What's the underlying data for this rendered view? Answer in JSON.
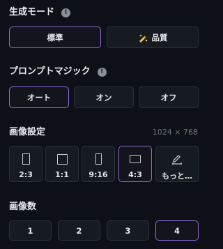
{
  "generation_mode": {
    "title": "生成モード",
    "options": [
      {
        "label": "標準",
        "selected": true
      },
      {
        "label": "品質",
        "selected": false,
        "icon": "sparkle-pen-icon"
      }
    ]
  },
  "prompt_magic": {
    "title": "プロンプトマジック",
    "options": [
      {
        "label": "オート",
        "selected": true
      },
      {
        "label": "オン",
        "selected": false
      },
      {
        "label": "オフ",
        "selected": false
      }
    ]
  },
  "image_settings": {
    "title": "画像設定",
    "resolution": "1024 × 768",
    "ratios": [
      {
        "label": "2:3",
        "selected": false
      },
      {
        "label": "1:1",
        "selected": false
      },
      {
        "label": "9:16",
        "selected": false
      },
      {
        "label": "4:3",
        "selected": true
      },
      {
        "label": "もっと…",
        "selected": false,
        "icon": "pencil-icon"
      }
    ]
  },
  "image_count": {
    "title": "画像数",
    "options": [
      {
        "label": "1",
        "selected": false
      },
      {
        "label": "2",
        "selected": false
      },
      {
        "label": "3",
        "selected": false
      },
      {
        "label": "4",
        "selected": true
      }
    ]
  },
  "colors": {
    "background": "#0d1117",
    "button_bg": "#161b22",
    "border": "#2c323b",
    "selected_border": "#8f6bd6",
    "accent_yellow": "#f2c14e"
  }
}
